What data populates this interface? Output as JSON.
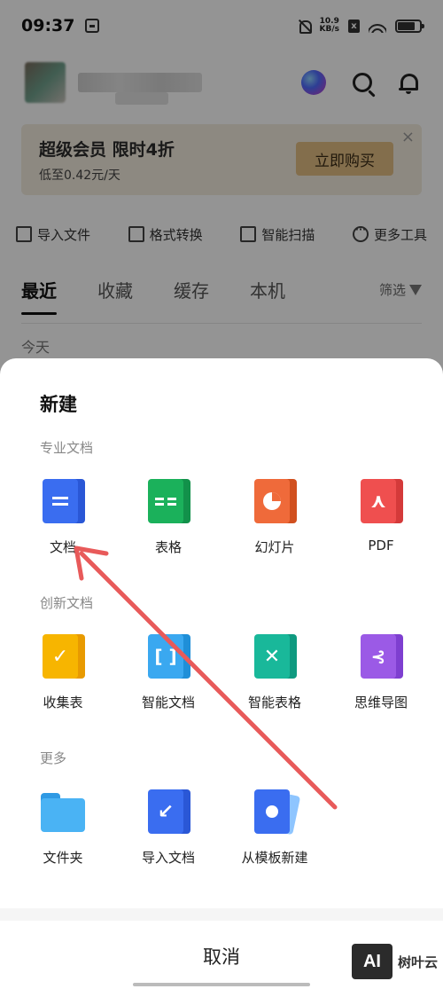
{
  "status_bar": {
    "time": "09:37",
    "speed_value": "10.9",
    "speed_unit": "KB/s",
    "sim_badge": "x"
  },
  "header": {
    "icons": [
      "ai-assistant-icon",
      "search-icon",
      "bell-icon"
    ]
  },
  "promo": {
    "title": "超级会员 限时4折",
    "subtitle": "低至0.42元/天",
    "button": "立即购买",
    "close": "×"
  },
  "tools": [
    "导入文件",
    "格式转换",
    "智能扫描",
    "更多工具"
  ],
  "tabs": [
    "最近",
    "收藏",
    "缓存",
    "本机"
  ],
  "filter_label": "筛选",
  "section_today": "今天",
  "sheet": {
    "title": "新建",
    "sections": [
      {
        "label": "专业文档",
        "items": [
          {
            "label": "文档",
            "icon": "document-icon",
            "color": "#3a6df0"
          },
          {
            "label": "表格",
            "icon": "spreadsheet-icon",
            "color": "#1bb15b"
          },
          {
            "label": "幻灯片",
            "icon": "slides-icon",
            "color": "#ef6a3a"
          },
          {
            "label": "PDF",
            "icon": "pdf-icon",
            "color": "#ef4f4f"
          }
        ]
      },
      {
        "label": "创新文档",
        "items": [
          {
            "label": "收集表",
            "icon": "form-icon",
            "color": "#f7b500"
          },
          {
            "label": "智能文档",
            "icon": "smart-doc-icon",
            "color": "#3aa8f0"
          },
          {
            "label": "智能表格",
            "icon": "smart-sheet-icon",
            "color": "#19b89a"
          },
          {
            "label": "思维导图",
            "icon": "mindmap-icon",
            "color": "#9b5ae6"
          }
        ]
      },
      {
        "label": "更多",
        "items": [
          {
            "label": "文件夹",
            "icon": "folder-icon",
            "color": "#4ab3f4"
          },
          {
            "label": "导入文档",
            "icon": "import-doc-icon",
            "color": "#3a6df0"
          },
          {
            "label": "从模板新建",
            "icon": "template-icon",
            "color": "#3a6df0"
          }
        ]
      }
    ],
    "cancel": "取消"
  },
  "watermark": {
    "logo": "AI",
    "text": "树叶云"
  },
  "annotation_arrow_color": "#e85a5a"
}
